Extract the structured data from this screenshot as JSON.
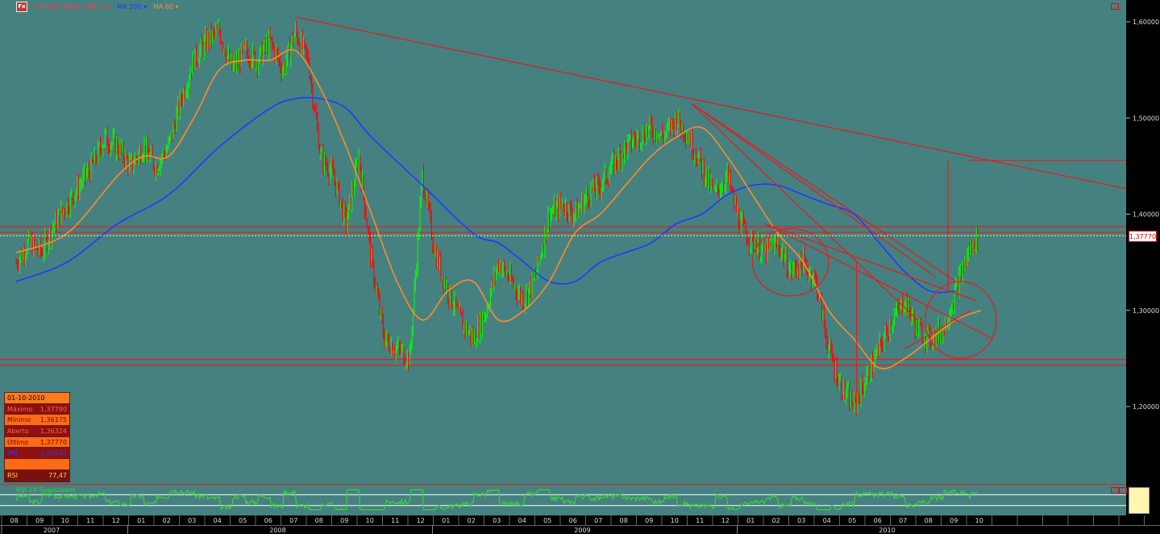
{
  "header": {
    "badge": "Fx",
    "title": "EURUSD Diário 1M(-5) ▾",
    "ma200_label": "MA 200 ▾",
    "ma60_label": "MA 60 ▾"
  },
  "colors": {
    "background": "#468181",
    "price_up": "#00ff00",
    "price_down": "#ff0000",
    "ma200": "#1a3cff",
    "ma60": "#ff8c2a",
    "trendline": "#e02020",
    "rsi": "#3cd23c",
    "current_price_line": "#ffff66"
  },
  "info_panel": {
    "date": "01-10-2010",
    "rows": [
      {
        "label": "Máximo",
        "value": "1,37790",
        "style": "dark"
      },
      {
        "label": "Mínimo",
        "value": "1,36175",
        "style": "orng"
      },
      {
        "label": "Aberto",
        "value": "1,36324",
        "style": "dark"
      },
      {
        "label": "Último",
        "value": "1,37770",
        "style": "orng"
      },
      {
        "label": "(M)",
        "value": "1,31682",
        "style": "blue"
      }
    ],
    "rsi_label": "RSI",
    "rsi_value": "77,47"
  },
  "current_price_label": "1,37770",
  "rsi_panel_label": "RSI 14 Suavizados",
  "chart_data": {
    "type": "line",
    "title": "EURUSD Diário",
    "instrument": "EURUSD",
    "timeframe": "Diário",
    "ylim": [
      1.1,
      1.62
    ],
    "y_ticks": [
      "1,60000",
      "1,50000",
      "1,40000",
      "1,30000",
      "1,20000"
    ],
    "y_tick_values": [
      1.6,
      1.5,
      1.4,
      1.3,
      1.2
    ],
    "x_axis": {
      "months": [
        "08",
        "09",
        "10",
        "11",
        "12",
        "01",
        "02",
        "03",
        "04",
        "05",
        "06",
        "07",
        "08",
        "09",
        "10",
        "11",
        "12",
        "01",
        "02",
        "03",
        "04",
        "05",
        "06",
        "07",
        "08",
        "09",
        "10",
        "11",
        "12",
        "01",
        "02",
        "03",
        "04",
        "05",
        "06",
        "07",
        "08",
        "09",
        "10"
      ],
      "years": [
        {
          "label": "2007",
          "month_index": 0
        },
        {
          "label": "2008",
          "month_index": 5
        },
        {
          "label": "2009",
          "month_index": 17
        },
        {
          "label": "2010",
          "month_index": 29
        }
      ],
      "extra_empty_months": 7
    },
    "series": [
      {
        "name": "EURUSD",
        "kind": "price",
        "points": [
          [
            0,
            1.35
          ],
          [
            0.5,
            1.37
          ],
          [
            1,
            1.36
          ],
          [
            1.5,
            1.39
          ],
          [
            2,
            1.41
          ],
          [
            2.5,
            1.43
          ],
          [
            3,
            1.45
          ],
          [
            3.5,
            1.48
          ],
          [
            4,
            1.47
          ],
          [
            4.5,
            1.45
          ],
          [
            5,
            1.47
          ],
          [
            5.5,
            1.45
          ],
          [
            6,
            1.47
          ],
          [
            6.5,
            1.52
          ],
          [
            7,
            1.56
          ],
          [
            7.5,
            1.58
          ],
          [
            8,
            1.59
          ],
          [
            8.5,
            1.55
          ],
          [
            9,
            1.57
          ],
          [
            9.5,
            1.56
          ],
          [
            10,
            1.58
          ],
          [
            10.5,
            1.55
          ],
          [
            11,
            1.59
          ],
          [
            11.5,
            1.56
          ],
          [
            12,
            1.46
          ],
          [
            12.5,
            1.44
          ],
          [
            13,
            1.39
          ],
          [
            13.5,
            1.46
          ],
          [
            14,
            1.35
          ],
          [
            14.5,
            1.27
          ],
          [
            15,
            1.26
          ],
          [
            15.5,
            1.25
          ],
          [
            16,
            1.44
          ],
          [
            16.5,
            1.36
          ],
          [
            17,
            1.32
          ],
          [
            17.5,
            1.29
          ],
          [
            18,
            1.27
          ],
          [
            18.5,
            1.3
          ],
          [
            19,
            1.35
          ],
          [
            19.5,
            1.33
          ],
          [
            20,
            1.31
          ],
          [
            20.5,
            1.34
          ],
          [
            21,
            1.4
          ],
          [
            21.5,
            1.41
          ],
          [
            22,
            1.4
          ],
          [
            22.5,
            1.42
          ],
          [
            23,
            1.43
          ],
          [
            23.5,
            1.45
          ],
          [
            24,
            1.47
          ],
          [
            24.5,
            1.48
          ],
          [
            25,
            1.49
          ],
          [
            25.5,
            1.48
          ],
          [
            26,
            1.5
          ],
          [
            26.5,
            1.48
          ],
          [
            27,
            1.45
          ],
          [
            27.5,
            1.42
          ],
          [
            28,
            1.44
          ],
          [
            28.5,
            1.39
          ],
          [
            29,
            1.37
          ],
          [
            29.5,
            1.36
          ],
          [
            30,
            1.37
          ],
          [
            30.5,
            1.34
          ],
          [
            31,
            1.35
          ],
          [
            31.5,
            1.33
          ],
          [
            32,
            1.26
          ],
          [
            32.5,
            1.22
          ],
          [
            33,
            1.2
          ],
          [
            33.5,
            1.23
          ],
          [
            34,
            1.26
          ],
          [
            34.5,
            1.29
          ],
          [
            35,
            1.31
          ],
          [
            35.5,
            1.28
          ],
          [
            36,
            1.27
          ],
          [
            36.5,
            1.28
          ],
          [
            37,
            1.32
          ],
          [
            37.5,
            1.36
          ],
          [
            37.9,
            1.3777
          ]
        ]
      },
      {
        "name": "MA 200",
        "kind": "ma200",
        "points": [
          [
            0,
            1.33
          ],
          [
            2,
            1.35
          ],
          [
            4,
            1.39
          ],
          [
            6,
            1.42
          ],
          [
            8,
            1.47
          ],
          [
            10,
            1.51
          ],
          [
            11,
            1.52
          ],
          [
            12,
            1.52
          ],
          [
            13,
            1.51
          ],
          [
            14,
            1.48
          ],
          [
            16,
            1.43
          ],
          [
            18,
            1.38
          ],
          [
            19,
            1.37
          ],
          [
            20,
            1.35
          ],
          [
            21,
            1.33
          ],
          [
            22,
            1.33
          ],
          [
            23,
            1.35
          ],
          [
            24,
            1.36
          ],
          [
            25,
            1.37
          ],
          [
            26,
            1.39
          ],
          [
            27,
            1.4
          ],
          [
            28,
            1.42
          ],
          [
            29,
            1.43
          ],
          [
            30,
            1.43
          ],
          [
            31,
            1.42
          ],
          [
            32,
            1.41
          ],
          [
            33,
            1.4
          ],
          [
            34,
            1.37
          ],
          [
            35,
            1.34
          ],
          [
            36,
            1.32
          ],
          [
            37,
            1.32
          ]
        ]
      },
      {
        "name": "MA 60",
        "kind": "ma60",
        "points": [
          [
            0,
            1.36
          ],
          [
            2,
            1.38
          ],
          [
            4,
            1.44
          ],
          [
            5,
            1.46
          ],
          [
            6,
            1.46
          ],
          [
            7,
            1.5
          ],
          [
            8,
            1.55
          ],
          [
            9,
            1.56
          ],
          [
            10,
            1.56
          ],
          [
            11,
            1.57
          ],
          [
            12,
            1.53
          ],
          [
            13,
            1.47
          ],
          [
            14,
            1.4
          ],
          [
            15,
            1.33
          ],
          [
            16,
            1.29
          ],
          [
            17,
            1.32
          ],
          [
            18,
            1.33
          ],
          [
            19,
            1.29
          ],
          [
            20,
            1.3
          ],
          [
            21,
            1.33
          ],
          [
            22,
            1.38
          ],
          [
            23,
            1.4
          ],
          [
            24,
            1.43
          ],
          [
            25,
            1.46
          ],
          [
            26,
            1.48
          ],
          [
            27,
            1.49
          ],
          [
            28,
            1.46
          ],
          [
            29,
            1.42
          ],
          [
            30,
            1.38
          ],
          [
            31,
            1.35
          ],
          [
            32,
            1.3
          ],
          [
            33,
            1.27
          ],
          [
            34,
            1.24
          ],
          [
            35,
            1.25
          ],
          [
            36,
            1.27
          ],
          [
            37,
            1.29
          ],
          [
            38,
            1.3
          ]
        ]
      }
    ],
    "annotations": {
      "horizontal_lines": [
        1.387,
        1.381,
        1.249,
        1.243,
        1.456
      ],
      "current_price": 1.3777,
      "trendlines": [
        [
          [
            11,
            1.605
          ],
          [
            44,
            1.425
          ]
        ],
        [
          [
            26.6,
            1.515
          ],
          [
            36.2,
            1.335
          ]
        ],
        [
          [
            26.6,
            1.515
          ],
          [
            37,
            1.33
          ]
        ],
        [
          [
            26.6,
            1.515
          ],
          [
            35.5,
            1.29
          ]
        ],
        [
          [
            29.5,
            1.39
          ],
          [
            37.8,
            1.31
          ]
        ],
        [
          [
            29.5,
            1.39
          ],
          [
            38.5,
            1.27
          ]
        ],
        [
          [
            35,
            1.26
          ],
          [
            37.6,
            1.3
          ]
        ]
      ],
      "vertical_lines": [
        [
          33.1,
          1.19,
          1.35
        ],
        [
          36.7,
          1.32,
          1.455
        ]
      ],
      "ellipses": [
        [
          30.5,
          1.35,
          1.5,
          0.035
        ],
        [
          37.2,
          1.29,
          1.4,
          0.04
        ]
      ]
    },
    "rsi": {
      "name": "RSI 14 Suavizados",
      "last_value": 77.47,
      "levels": [
        70,
        30
      ]
    },
    "grid": false,
    "legend": "top-left"
  }
}
